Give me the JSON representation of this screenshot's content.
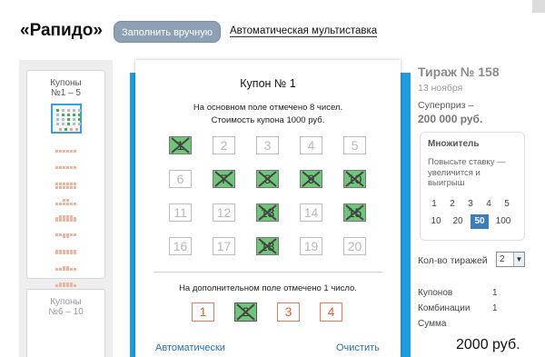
{
  "header": {
    "logo": "«Рапидо»",
    "manual_tab": "Заполнить вручную",
    "auto_tab": "Автоматическая мультиставка"
  },
  "sidebar": {
    "groups": [
      {
        "title": "Купоны\n№1 – 5",
        "line1": "Купоны",
        "line2": "№1 – 5"
      },
      {
        "title": "Купоны\n№6 – 10",
        "line1": "Купоны",
        "line2": "№6 – 10"
      }
    ]
  },
  "coupon": {
    "title": "Купон № 1",
    "info_line1": "На основном поле отмечено 8 чисел.",
    "info_line2": "Стоимость купона 1000 руб.",
    "main_numbers": [
      {
        "n": "1",
        "selected": true
      },
      {
        "n": "2",
        "selected": false
      },
      {
        "n": "3",
        "selected": false
      },
      {
        "n": "4",
        "selected": false
      },
      {
        "n": "5",
        "selected": false
      },
      {
        "n": "6",
        "selected": false
      },
      {
        "n": "7",
        "selected": true
      },
      {
        "n": "8",
        "selected": true
      },
      {
        "n": "9",
        "selected": true
      },
      {
        "n": "10",
        "selected": true
      },
      {
        "n": "11",
        "selected": false
      },
      {
        "n": "12",
        "selected": false
      },
      {
        "n": "13",
        "selected": true
      },
      {
        "n": "14",
        "selected": false
      },
      {
        "n": "15",
        "selected": true
      },
      {
        "n": "16",
        "selected": false
      },
      {
        "n": "17",
        "selected": false
      },
      {
        "n": "18",
        "selected": true
      },
      {
        "n": "19",
        "selected": false
      },
      {
        "n": "20",
        "selected": false
      }
    ],
    "extra_info": "На дополнительном поле отмечено 1 число.",
    "extra_numbers": [
      {
        "n": "1",
        "selected": false
      },
      {
        "n": "2",
        "selected": true
      },
      {
        "n": "3",
        "selected": false
      },
      {
        "n": "4",
        "selected": false
      }
    ],
    "auto_link": "Автоматически",
    "clear_link": "Очистить"
  },
  "draw": {
    "title": "Тираж № 158",
    "date": "13 ноября",
    "prize_label": "Суперприз –",
    "prize_value": "200 000 руб."
  },
  "multiplier": {
    "title": "Множитель",
    "text": "Повысьте ставку — увеличится и выигрыш",
    "options": [
      "1",
      "2",
      "3",
      "4",
      "5",
      "10",
      "20",
      "50",
      "100"
    ],
    "selected": "50"
  },
  "draws_count": {
    "label": "Кол-во тиражей",
    "value": "2"
  },
  "summary": {
    "coupons_label": "Купонов",
    "coupons_value": "1",
    "combos_label": "Комбинации",
    "combos_value": "1",
    "sum_label": "Сумма",
    "total": "2000 руб."
  },
  "colors": {
    "accent_blue": "#1f9ce0",
    "selected_green": "#6fc57a",
    "extra_orange": "#e07a5a",
    "multiplier_active": "#3d7eb8"
  }
}
